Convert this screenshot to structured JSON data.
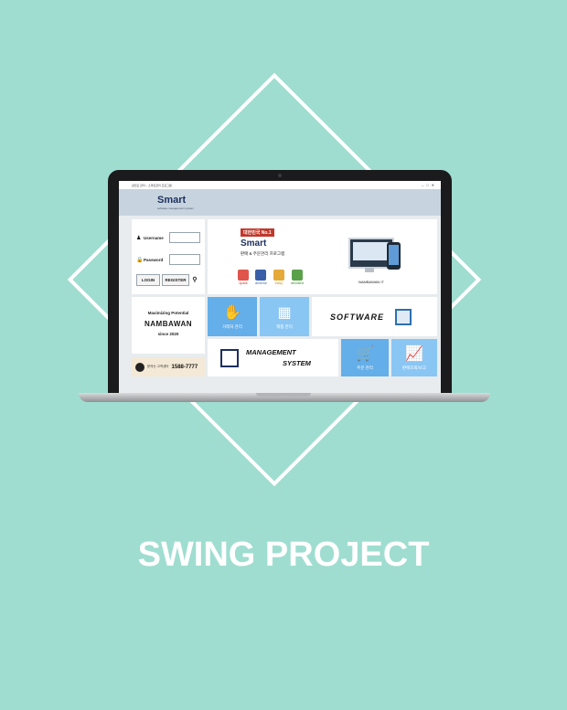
{
  "app": {
    "window_title": "샵인모 관리 – 스마트관리 프로그램",
    "logo": "Smart",
    "logo_subtitle": "software management system"
  },
  "login": {
    "username_label": "Username",
    "password_label": "Password",
    "login_button": "LOGIN",
    "register_button": "REGISTER"
  },
  "promo": {
    "badge": "대한민국 No.1",
    "brand": "Smart",
    "tagline": "판매 & 주문관리 프로그램",
    "features": [
      "quick",
      "diverse",
      "easy",
      "detailed"
    ],
    "device_label": "NAMBAWAN IT"
  },
  "brand_card": {
    "line1": "Maximizing Potential",
    "name": "NAMBAWAN",
    "since": "since 2020"
  },
  "contact": {
    "label": "문의는 고객센터",
    "phone": "1588-7777"
  },
  "tiles": {
    "customer": "거래처 관리",
    "product": "제품 관리",
    "order": "주문 관리",
    "stats": "판매조회/보고"
  },
  "banners": {
    "software": "SOFTWARE",
    "management": "MANAGEMENT",
    "system": "SYSTEM"
  },
  "page": {
    "heading": "SWING PROJECT"
  },
  "colors": {
    "background": "#9fddd0",
    "tile_blue": "#64aee9",
    "tile_light": "#8ac6f3",
    "badge_red": "#c0392b"
  }
}
